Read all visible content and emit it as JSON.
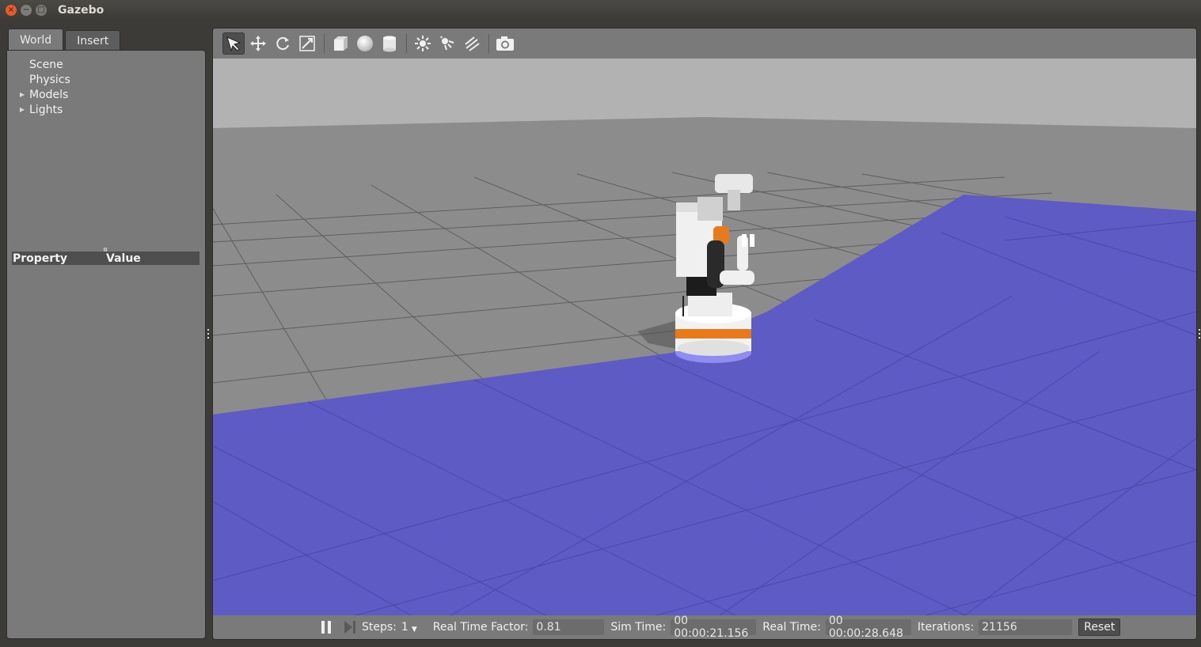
{
  "window": {
    "title": "Gazebo",
    "close_glyph": "×",
    "min_glyph": "−",
    "max_glyph": "□"
  },
  "left_panel": {
    "tabs": [
      {
        "label": "World",
        "active": true
      },
      {
        "label": "Insert",
        "active": false
      }
    ],
    "tree": [
      {
        "label": "Scene",
        "expandable": false
      },
      {
        "label": "Physics",
        "expandable": false
      },
      {
        "label": "Models",
        "expandable": true
      },
      {
        "label": "Lights",
        "expandable": true
      }
    ],
    "property_header": {
      "property": "Property",
      "value": "Value"
    }
  },
  "toolbar": {
    "tools": [
      {
        "name": "select-mode",
        "icon": "arrow-cursor-icon",
        "active": true
      },
      {
        "name": "translate-mode",
        "icon": "move-arrows-icon",
        "active": false
      },
      {
        "name": "rotate-mode",
        "icon": "rotate-icon",
        "active": false
      },
      {
        "name": "scale-mode",
        "icon": "scale-icon",
        "active": false
      },
      {
        "name": "insert-box",
        "icon": "box-icon",
        "active": false
      },
      {
        "name": "insert-sphere",
        "icon": "sphere-icon",
        "active": false
      },
      {
        "name": "insert-cylinder",
        "icon": "cylinder-icon",
        "active": false
      },
      {
        "name": "point-light",
        "icon": "point-light-icon",
        "active": false
      },
      {
        "name": "spot-light",
        "icon": "spot-light-icon",
        "active": false
      },
      {
        "name": "directional-light",
        "icon": "directional-light-icon",
        "active": false
      },
      {
        "name": "screenshot",
        "icon": "camera-icon",
        "active": false
      }
    ]
  },
  "scene": {
    "sky_color": "#b2b2b2",
    "ground_color": "#8c8c8c",
    "floor_color": "#5e5bc4",
    "robot_accent_color": "#e87a1e"
  },
  "bottom_bar": {
    "steps_label": "Steps:",
    "steps_value": "1",
    "rtf_label": "Real Time Factor:",
    "rtf_value": "0.81",
    "sim_time_label": "Sim Time:",
    "sim_time_value": "00 00:00:21.156",
    "real_time_label": "Real Time:",
    "real_time_value": "00 00:00:28.648",
    "iterations_label": "Iterations:",
    "iterations_value": "21156",
    "reset_label": "Reset"
  }
}
